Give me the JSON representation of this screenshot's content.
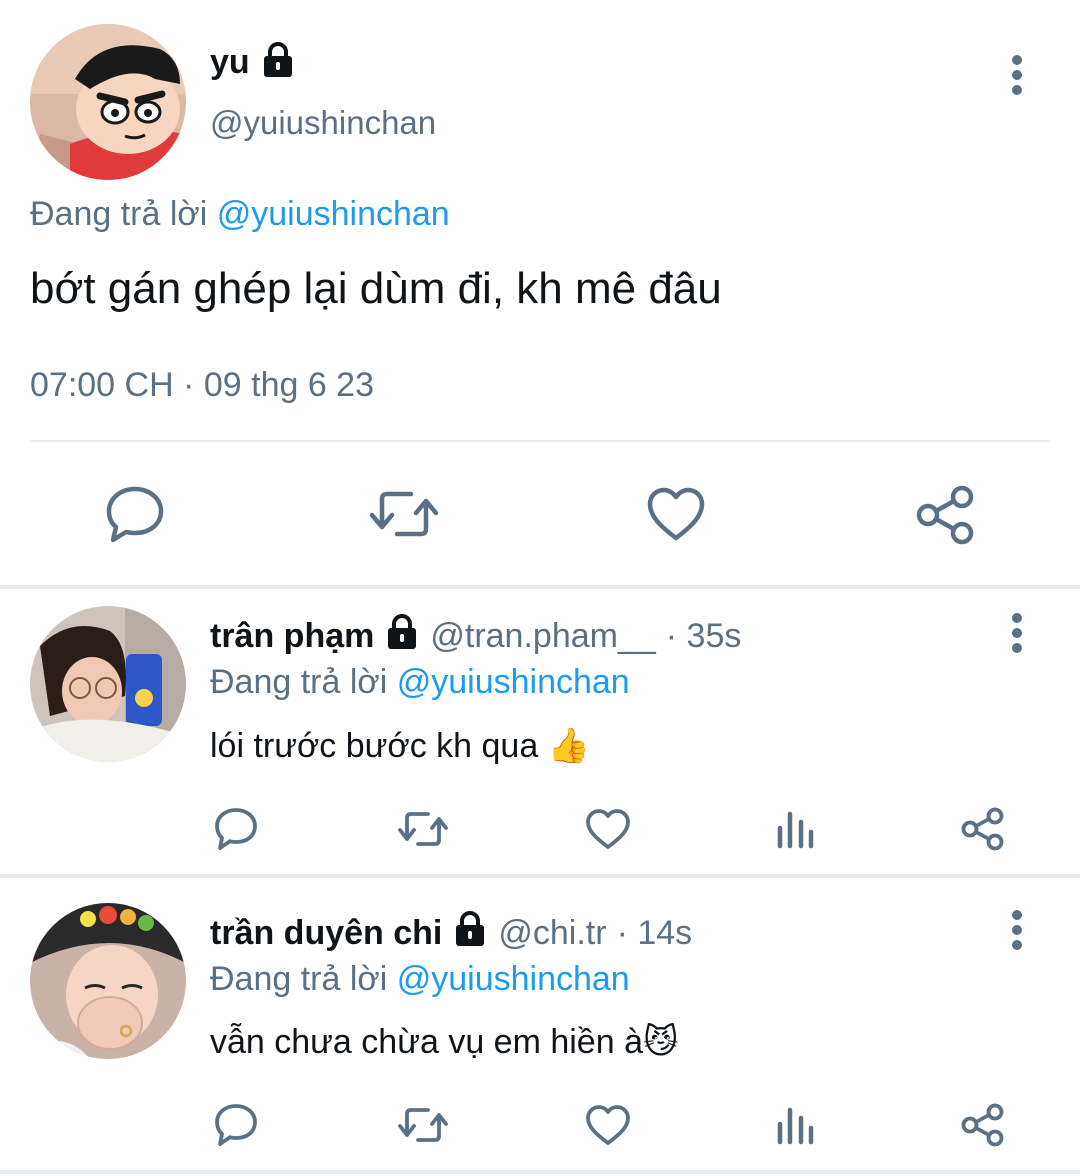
{
  "main_tweet": {
    "name": "yu",
    "handle": "@yuiushinchan",
    "replying_label": "Đang trả lời",
    "replying_to": "@yuiushinchan",
    "text": "bớt gán ghép lại dùm đi, kh mê đâu",
    "timestamp": "07:00 CH · 09 thg 6 23",
    "actions": [
      "reply-icon",
      "retweet-icon",
      "like-icon",
      "share-icon"
    ]
  },
  "replies": [
    {
      "name": "trân phạm",
      "handle": "@tran.pham__",
      "time": "· 35s",
      "replying_label": "Đang trả lời",
      "replying_to": "@yuiushinchan",
      "text": "lói trước bước kh qua",
      "emoji": "👍",
      "actions": [
        "reply-icon",
        "retweet-icon",
        "like-icon",
        "analytics-icon",
        "share-icon"
      ]
    },
    {
      "name": "trần duyên chi",
      "handle": "@chi.tr",
      "time": "· 14s",
      "replying_label": "Đang trả lời",
      "replying_to": "@yuiushinchan",
      "text": "vẫn chưa chừa vụ em hiền à",
      "emoji": "😼",
      "actions": [
        "reply-icon",
        "retweet-icon",
        "like-icon",
        "analytics-icon",
        "share-icon"
      ]
    }
  ],
  "colors": {
    "link": "#1d9bf0",
    "secondary_text": "#5b7083",
    "primary_text": "#0f1419"
  }
}
